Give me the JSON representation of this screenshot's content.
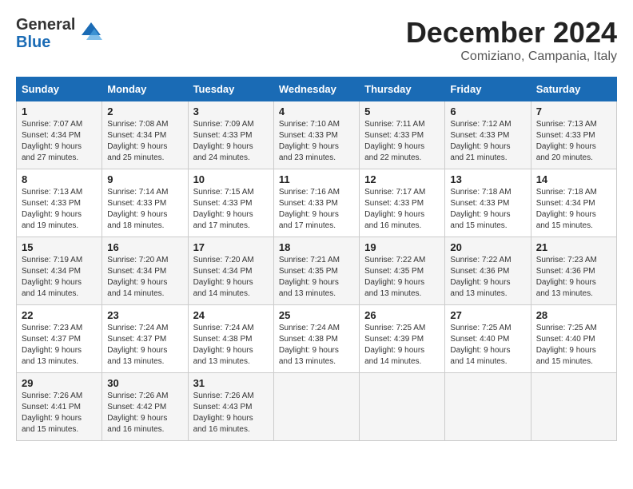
{
  "header": {
    "logo_general": "General",
    "logo_blue": "Blue",
    "title": "December 2024",
    "location": "Comiziano, Campania, Italy"
  },
  "days_of_week": [
    "Sunday",
    "Monday",
    "Tuesday",
    "Wednesday",
    "Thursday",
    "Friday",
    "Saturday"
  ],
  "weeks": [
    [
      {
        "day": "1",
        "info": "Sunrise: 7:07 AM\nSunset: 4:34 PM\nDaylight: 9 hours\nand 27 minutes."
      },
      {
        "day": "2",
        "info": "Sunrise: 7:08 AM\nSunset: 4:34 PM\nDaylight: 9 hours\nand 25 minutes."
      },
      {
        "day": "3",
        "info": "Sunrise: 7:09 AM\nSunset: 4:33 PM\nDaylight: 9 hours\nand 24 minutes."
      },
      {
        "day": "4",
        "info": "Sunrise: 7:10 AM\nSunset: 4:33 PM\nDaylight: 9 hours\nand 23 minutes."
      },
      {
        "day": "5",
        "info": "Sunrise: 7:11 AM\nSunset: 4:33 PM\nDaylight: 9 hours\nand 22 minutes."
      },
      {
        "day": "6",
        "info": "Sunrise: 7:12 AM\nSunset: 4:33 PM\nDaylight: 9 hours\nand 21 minutes."
      },
      {
        "day": "7",
        "info": "Sunrise: 7:13 AM\nSunset: 4:33 PM\nDaylight: 9 hours\nand 20 minutes."
      }
    ],
    [
      {
        "day": "8",
        "info": "Sunrise: 7:13 AM\nSunset: 4:33 PM\nDaylight: 9 hours\nand 19 minutes."
      },
      {
        "day": "9",
        "info": "Sunrise: 7:14 AM\nSunset: 4:33 PM\nDaylight: 9 hours\nand 18 minutes."
      },
      {
        "day": "10",
        "info": "Sunrise: 7:15 AM\nSunset: 4:33 PM\nDaylight: 9 hours\nand 17 minutes."
      },
      {
        "day": "11",
        "info": "Sunrise: 7:16 AM\nSunset: 4:33 PM\nDaylight: 9 hours\nand 17 minutes."
      },
      {
        "day": "12",
        "info": "Sunrise: 7:17 AM\nSunset: 4:33 PM\nDaylight: 9 hours\nand 16 minutes."
      },
      {
        "day": "13",
        "info": "Sunrise: 7:18 AM\nSunset: 4:33 PM\nDaylight: 9 hours\nand 15 minutes."
      },
      {
        "day": "14",
        "info": "Sunrise: 7:18 AM\nSunset: 4:34 PM\nDaylight: 9 hours\nand 15 minutes."
      }
    ],
    [
      {
        "day": "15",
        "info": "Sunrise: 7:19 AM\nSunset: 4:34 PM\nDaylight: 9 hours\nand 14 minutes."
      },
      {
        "day": "16",
        "info": "Sunrise: 7:20 AM\nSunset: 4:34 PM\nDaylight: 9 hours\nand 14 minutes."
      },
      {
        "day": "17",
        "info": "Sunrise: 7:20 AM\nSunset: 4:34 PM\nDaylight: 9 hours\nand 14 minutes."
      },
      {
        "day": "18",
        "info": "Sunrise: 7:21 AM\nSunset: 4:35 PM\nDaylight: 9 hours\nand 13 minutes."
      },
      {
        "day": "19",
        "info": "Sunrise: 7:22 AM\nSunset: 4:35 PM\nDaylight: 9 hours\nand 13 minutes."
      },
      {
        "day": "20",
        "info": "Sunrise: 7:22 AM\nSunset: 4:36 PM\nDaylight: 9 hours\nand 13 minutes."
      },
      {
        "day": "21",
        "info": "Sunrise: 7:23 AM\nSunset: 4:36 PM\nDaylight: 9 hours\nand 13 minutes."
      }
    ],
    [
      {
        "day": "22",
        "info": "Sunrise: 7:23 AM\nSunset: 4:37 PM\nDaylight: 9 hours\nand 13 minutes."
      },
      {
        "day": "23",
        "info": "Sunrise: 7:24 AM\nSunset: 4:37 PM\nDaylight: 9 hours\nand 13 minutes."
      },
      {
        "day": "24",
        "info": "Sunrise: 7:24 AM\nSunset: 4:38 PM\nDaylight: 9 hours\nand 13 minutes."
      },
      {
        "day": "25",
        "info": "Sunrise: 7:24 AM\nSunset: 4:38 PM\nDaylight: 9 hours\nand 13 minutes."
      },
      {
        "day": "26",
        "info": "Sunrise: 7:25 AM\nSunset: 4:39 PM\nDaylight: 9 hours\nand 14 minutes."
      },
      {
        "day": "27",
        "info": "Sunrise: 7:25 AM\nSunset: 4:40 PM\nDaylight: 9 hours\nand 14 minutes."
      },
      {
        "day": "28",
        "info": "Sunrise: 7:25 AM\nSunset: 4:40 PM\nDaylight: 9 hours\nand 15 minutes."
      }
    ],
    [
      {
        "day": "29",
        "info": "Sunrise: 7:26 AM\nSunset: 4:41 PM\nDaylight: 9 hours\nand 15 minutes."
      },
      {
        "day": "30",
        "info": "Sunrise: 7:26 AM\nSunset: 4:42 PM\nDaylight: 9 hours\nand 16 minutes."
      },
      {
        "day": "31",
        "info": "Sunrise: 7:26 AM\nSunset: 4:43 PM\nDaylight: 9 hours\nand 16 minutes."
      },
      {
        "day": "",
        "info": ""
      },
      {
        "day": "",
        "info": ""
      },
      {
        "day": "",
        "info": ""
      },
      {
        "day": "",
        "info": ""
      }
    ]
  ]
}
